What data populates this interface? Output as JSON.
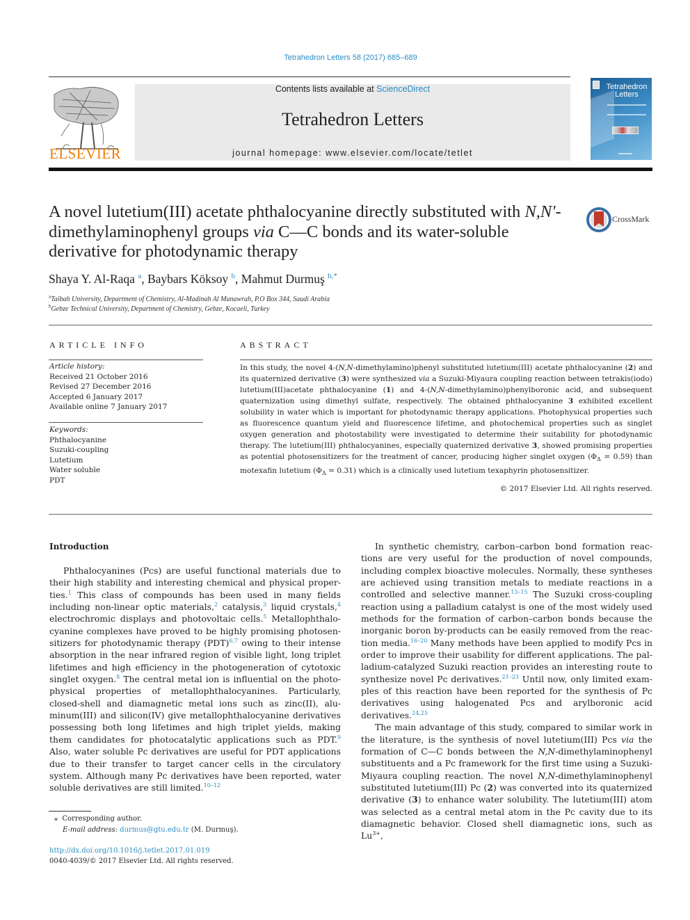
{
  "header": {
    "citation": "Tetrahedron Letters 58 (2017) 685–689",
    "contents_prefix": "Contents lists available at ",
    "contents_link": "ScienceDirect",
    "journal_title": "Tetrahedron Letters",
    "homepage": "journal homepage: www.elsevier.com/locate/tetlet",
    "publisher": "ELSEVIER",
    "cover_title_1": "Tetrahedron",
    "cover_title_2": "Letters"
  },
  "article": {
    "title_part1": "A novel lutetium(III) acetate phthalocyanine directly substituted with ",
    "title_italic1": "N,N'",
    "title_part2": "-dimethylaminophenyl groups ",
    "title_italic2": "via",
    "title_part3": " C—C bonds and its water-soluble derivative for photodynamic therapy",
    "crossmark": "CrossMark",
    "authors": [
      {
        "name": "Shaya Y. Al-Raqa",
        "sup": "a"
      },
      {
        "name": "Baybars Köksoy",
        "sup": "b"
      },
      {
        "name": "Mahmut Durmuş",
        "sup": "b,*"
      }
    ],
    "affiliations": [
      {
        "sup": "a",
        "text": "Taibah University, Department of Chemistry, Al-Madinah Al Munawrah, P.O Box 344, Saudi Arabia"
      },
      {
        "sup": "b",
        "text": "Gebze Technical University, Department of Chemistry, Gebze, Kocaeli, Turkey"
      }
    ]
  },
  "article_info": {
    "heading": "ARTICLE INFO",
    "history_label": "Article history:",
    "history": [
      "Received 21 October 2016",
      "Revised 27 December 2016",
      "Accepted 6 January 2017",
      "Available online 7 January 2017"
    ],
    "keywords_label": "Keywords:",
    "keywords": [
      "Phthalocyanine",
      "Suzuki-coupling",
      "Lutetium",
      "Water soluble",
      "PDT"
    ]
  },
  "abstract": {
    "heading": "ABSTRACT",
    "s1": "In this study, the novel 4-(",
    "s1i": "N,N",
    "s2": "-dimethylamino)phenyl substituted lutetium(III) acetate phthalocyanine (",
    "c2": "2",
    "s3": ") and its quaternized derivative (",
    "c3": "3",
    "s4": ") were synthesized ",
    "via": "via",
    "s5": " a Suzuki-Miyaura coupling reaction between tetrakis(iodo) lutetium(III)acetate phthalocyanine (",
    "c1": "1",
    "s6": ") and 4-(",
    "s6i": "N,N",
    "s7": "-dimethylamino)phenylboronic acid, and subsequent quaternization using dimethyl sulfate, respectively. The obtained phthalocyanine ",
    "c3b": "3",
    "s8": " exhibited excellent solubility in water which is important for photodynamic therapy applications. Photophysical properties such as fluorescence quantum yield and fluorescence lifetime, and photochemical properties such as singlet oxygen generation and photostability were investigated to determine their suitability for photodynamic therapy. The lutetium(III) phthalocyanines, especially quaternized derivative ",
    "c3c": "3",
    "s9": ", showed promising properties as potential photosensitizers for the treatment of cancer, producing higher singlet oxygen (Φ",
    "delta": "Δ",
    "s10": " = 0.59) than motexafin lutetium (Φ",
    "s11": " = 0.31) which is a clinically used lutetium texaphyrin photosensitizer.",
    "copyright": "© 2017 Elsevier Ltd. All rights reserved."
  },
  "introduction": {
    "heading": "Introduction",
    "p1": [
      {
        "t": "Phthalocyanines (Pcs) are useful functional materials due to their high stability and interesting chemical and physical proper­ties."
      },
      {
        "ref": "1"
      },
      {
        "t": " This class of compounds has been used in many fields includ­ing non-linear optic materials,"
      },
      {
        "ref": "2"
      },
      {
        "t": " catalysis,"
      },
      {
        "ref": "3"
      },
      {
        "t": " liquid crystals,"
      },
      {
        "ref": "4"
      },
      {
        "t": " electrochromic displays and photovoltaic cells."
      },
      {
        "ref": "5"
      },
      {
        "t": " Metallophthalo­cyanine complexes have proved to be highly promising photosen­sitizers for photodynamic therapy (PDT)"
      },
      {
        "ref": "6,7"
      },
      {
        "t": " owing to their intense absorption in the near infrared region of visible light, long triplet lifetimes and high efficiency in the photogeneration of cytotoxic singlet oxygen."
      },
      {
        "ref": "8"
      },
      {
        "t": " The central metal ion is influential on the photo­physical properties of metallophthalocyanines. Particularly, closed-shell and diamagnetic metal ions such as zinc(II), alu­minum(III) and silicon(IV) give metallophthalocyanine derivatives possessing both long lifetimes and high triplet yields, making them candidates for photocatalytic applications such as PDT."
      },
      {
        "ref": "9"
      },
      {
        "t": " Also, water soluble Pc derivatives are useful for PDT applications due to their transfer to target cancer cells in the circulatory system. Although many Pc derivatives have been reported, water soluble derivatives are still limited."
      },
      {
        "ref": "10–12"
      }
    ],
    "p2": [
      {
        "t": "In synthetic chemistry, carbon–carbon bond formation reac­tions are very useful for the production of novel compounds, including complex bioactive molecules. Normally, these syntheses are achieved using transition metals to mediate reactions in a con­trolled and selective manner."
      },
      {
        "ref": "13–15"
      },
      {
        "t": " The Suzuki cross-coupling reac­tion using a palladium catalyst is one of the most widely used methods for the formation of carbon–carbon bonds because the inorganic boron by-products can be easily removed from the reac­tion media."
      },
      {
        "ref": "16–20"
      },
      {
        "t": " Many methods have been applied to modify Pcs in order to improve their usability for different applications. The pal­ladium-catalyzed Suzuki reaction provides an interesting route to synthesize novel Pc derivatives."
      },
      {
        "ref": "21–23"
      },
      {
        "t": " Until now, only limited exam­ples of this reaction have been reported for the synthesis of Pc derivatives using halogenated Pcs and arylboronic acid derivatives."
      },
      {
        "ref": "24,25"
      }
    ],
    "p3": [
      {
        "t": "The main advantage of this study, compared to similar work in the literature, is the synthesis of novel lutetium(III) Pcs "
      },
      {
        "i": "via"
      },
      {
        "t": " the for­mation of C—C bonds between the "
      },
      {
        "i": "N,N"
      },
      {
        "t": "-dimethylaminophenyl sub­stituents and a Pc framework for the first time using a Suzuki-Miyaura coupling reaction. The novel "
      },
      {
        "i": "N,N"
      },
      {
        "t": "-dimethylaminophenyl substituted lutetium(III) Pc ("
      },
      {
        "b": "2"
      },
      {
        "t": ") was converted into its quaternized derivative ("
      },
      {
        "b": "3"
      },
      {
        "t": ") to enhance water solubility. The lutetium(III) atom was selected as a central metal atom in the Pc cavity due to its dia­magnetic behavior. Closed shell diamagnetic ions, such as Lu"
      },
      {
        "sb": "3+"
      },
      {
        "t": ","
      }
    ]
  },
  "footnote": {
    "star": "⁎",
    "corresponding": "Corresponding author.",
    "email_label": "E-mail address: ",
    "email": "durmus@gtu.edu.tr",
    "email_suffix": " (M. Durmuş)."
  },
  "doi": {
    "link": "http://dx.doi.org/10.1016/j.tetlet.2017.01.019",
    "issn": "0040-4039/© 2017 Elsevier Ltd. All rights reserved."
  },
  "colors": {
    "link": "#2b8dc2",
    "elsevier_orange": "#f07d00",
    "masthead_bg": "#eaeaea"
  }
}
